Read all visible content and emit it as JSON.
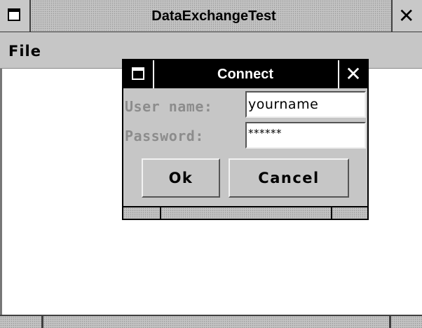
{
  "main_window": {
    "title": "DataExchangeTest",
    "close_glyph": "✕",
    "menu_icon": "window-menu-icon"
  },
  "menubar": {
    "items": [
      {
        "label": "File"
      }
    ]
  },
  "dialog": {
    "title": "Connect",
    "close_glyph": "✕",
    "fields": {
      "username": {
        "label": "User name:",
        "value": "yourname"
      },
      "password": {
        "label": "Password:",
        "value": "******"
      }
    },
    "buttons": {
      "ok": "Ok",
      "cancel": "Cancel"
    }
  },
  "colors": {
    "window_bg": "#c6c6c6",
    "dialog_titlebar": "#000000",
    "disabled_label": "#8c8c8c"
  }
}
